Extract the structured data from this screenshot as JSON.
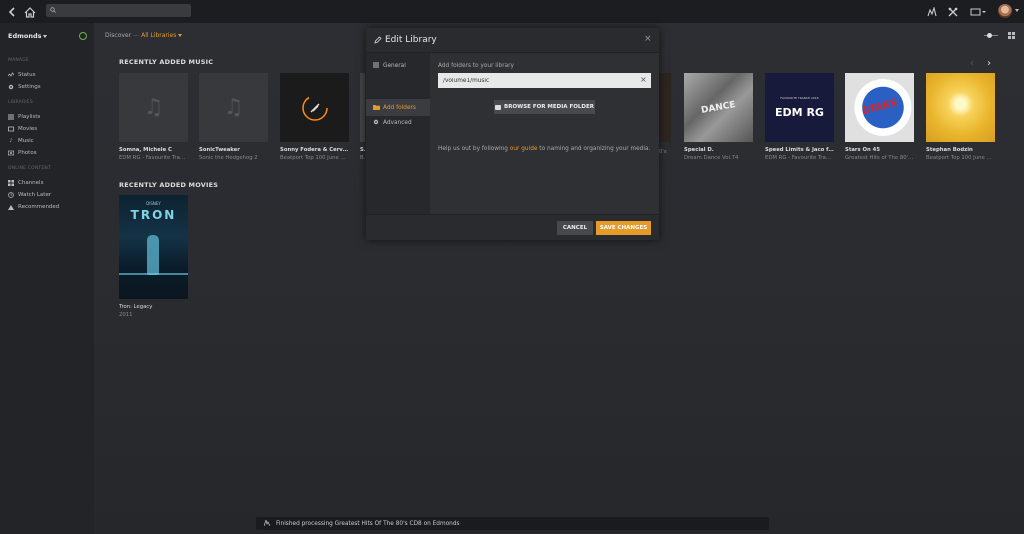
{
  "topbar": {
    "search_placeholder": "",
    "icons": [
      "back-icon",
      "home-icon",
      "search-icon",
      "activity-icon",
      "tools-icon",
      "cast-icon",
      "avatar"
    ]
  },
  "sidebar": {
    "server_name": "Edmonds",
    "manage_label": "MANAGE",
    "manage_items": [
      {
        "label": "Status",
        "icon": "status-icon"
      },
      {
        "label": "Settings",
        "icon": "gear-icon"
      }
    ],
    "libraries_label": "LIBRARIES",
    "library_items": [
      {
        "label": "Playlists",
        "icon": "playlist-icon"
      },
      {
        "label": "Movies",
        "icon": "movie-icon"
      },
      {
        "label": "Music",
        "icon": "music-icon"
      },
      {
        "label": "Photos",
        "icon": "photo-icon"
      }
    ],
    "online_label": "ONLINE CONTENT",
    "online_items": [
      {
        "label": "Channels",
        "icon": "channels-icon"
      },
      {
        "label": "Watch Later",
        "icon": "clock-icon"
      },
      {
        "label": "Recommended",
        "icon": "recommended-icon"
      }
    ]
  },
  "breadcrumb": {
    "discover": "Discover",
    "separator": "—",
    "current": "All Libraries"
  },
  "music": {
    "section_title": "RECENTLY ADDED MUSIC",
    "cards": [
      {
        "title": "Somna, Michele C",
        "subtitle": "EDM RG - Favourite Trance..."
      },
      {
        "title": "SonicTweaker",
        "subtitle": "Sonic the Hedgehog 2"
      },
      {
        "title": "Sonny Fodera & Cervanda...",
        "subtitle": "Beatport Top 100 June 20..."
      },
      {
        "title": "Sp",
        "subtitle": "Be"
      },
      {
        "title": "",
        "subtitle": "0's"
      },
      {
        "title": "Special D.",
        "subtitle": "Dream Dance Vol.74"
      },
      {
        "title": "Speed Limits & Jaco feat. ...",
        "subtitle": "EDM RG - Favourite Trance..."
      },
      {
        "title": "Stars On 45",
        "subtitle": "Greatest Hits of The 80's ..."
      },
      {
        "title": "Stephan Bodzin",
        "subtitle": "Beatport Top 100 June 20..."
      }
    ],
    "art_text": {
      "dream_dance": "DANCE",
      "edm_header": "FAVOURITE TRANCE 2018",
      "edm_logo": "EDM RG",
      "stars": "STARS"
    }
  },
  "movies": {
    "section_title": "RECENTLY ADDED MOVIES",
    "items": [
      {
        "title": "Tron: Legacy",
        "year": "2011",
        "poster_disney": "DISNEY",
        "poster_text": "TRON"
      }
    ]
  },
  "modal": {
    "title": "Edit Library",
    "tabs": [
      {
        "label": "General",
        "icon": "general-icon"
      },
      {
        "label": "Add folders",
        "icon": "folder-icon"
      },
      {
        "label": "Advanced",
        "icon": "gear-icon"
      }
    ],
    "active_tab": "Add folders",
    "body_label": "Add folders to your library",
    "folder_value": "/volume1/music",
    "browse_label": "BROWSE FOR MEDIA FOLDER",
    "help_pre": "Help us out by following ",
    "help_link": "our guide",
    "help_post": " to naming and organizing your media.",
    "cancel_label": "CANCEL",
    "save_label": "SAVE CHANGES"
  },
  "toast": {
    "message": "Finished processing Greatest Hits Of The 80's CD8 on Edmonds"
  },
  "colors": {
    "accent": "#e59b2a",
    "status_ok": "#6ab34a",
    "background": "#2a2c30"
  }
}
